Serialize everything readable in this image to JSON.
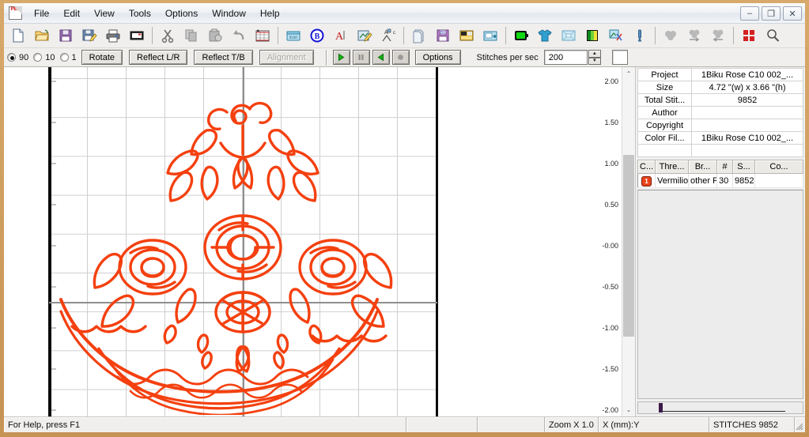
{
  "window": {
    "app_icon": "pes-file-icon",
    "minimize": "–",
    "maximize": "❐",
    "close": "✕"
  },
  "menu": {
    "items": [
      {
        "label": "File",
        "name": "menu-file"
      },
      {
        "label": "Edit",
        "name": "menu-edit"
      },
      {
        "label": "View",
        "name": "menu-view"
      },
      {
        "label": "Tools",
        "name": "menu-tools"
      },
      {
        "label": "Options",
        "name": "menu-options"
      },
      {
        "label": "Window",
        "name": "menu-window"
      },
      {
        "label": "Help",
        "name": "menu-help"
      }
    ]
  },
  "toolbar": {
    "buttons": [
      {
        "icon": "new-document-icon",
        "name": "new-button"
      },
      {
        "icon": "open-folder-icon",
        "name": "open-button"
      },
      {
        "icon": "save-floppy-icon",
        "name": "save-button"
      },
      {
        "icon": "save-as-floppy-pencil-icon",
        "name": "save-as-button"
      },
      {
        "icon": "printer-icon",
        "name": "print-button"
      },
      {
        "icon": "print-preview-icon",
        "name": "print-preview-button"
      },
      {
        "sep": true
      },
      {
        "icon": "scissors-cut-icon",
        "name": "cut-button"
      },
      {
        "icon": "copy-pages-icon",
        "name": "copy-button"
      },
      {
        "icon": "paste-clipboard-icon",
        "name": "paste-button"
      },
      {
        "icon": "undo-arrow-icon",
        "name": "undo-button"
      },
      {
        "icon": "grid-snap-icon",
        "name": "grid-button"
      },
      {
        "sep": true
      },
      {
        "icon": "icon-folder-icon",
        "name": "icon-view-button"
      },
      {
        "icon": "blue-b-circle-icon",
        "name": "b-button"
      },
      {
        "icon": "letter-a-icon",
        "name": "text-button"
      },
      {
        "icon": "edit-design-pencil-icon",
        "name": "edit-design-button"
      },
      {
        "icon": "stitch-path-icon",
        "name": "stitch-path-button"
      },
      {
        "sep": true
      },
      {
        "icon": "layers-stack-icon",
        "name": "layers-button"
      },
      {
        "icon": "floppy-d1-icon",
        "name": "card-write-button"
      },
      {
        "icon": "card-reader-icon",
        "name": "card-read-button"
      },
      {
        "icon": "machine-transfer-icon",
        "name": "machine-transfer-button"
      },
      {
        "sep": true
      },
      {
        "icon": "green-hoop-icon",
        "name": "hoop-button"
      },
      {
        "icon": "tshirt-icon",
        "name": "garment-button"
      },
      {
        "icon": "fabric-frame-icon",
        "name": "fabric-button"
      },
      {
        "icon": "gradient-bars-icon",
        "name": "color-gradient-button"
      },
      {
        "icon": "color-tools-icon",
        "name": "color-tools-button"
      },
      {
        "icon": "needle-icon",
        "name": "needle-button"
      },
      {
        "sep": true
      },
      {
        "icon": "cluster-gray-icon",
        "name": "group-button"
      },
      {
        "icon": "cluster-right-arrow-icon",
        "name": "move-right-button"
      },
      {
        "icon": "cluster-left-arrow-icon",
        "name": "move-left-button"
      },
      {
        "sep": true
      },
      {
        "icon": "four-squares-red-icon",
        "name": "tile-button"
      },
      {
        "icon": "magnifier-icon",
        "name": "zoom-button"
      }
    ]
  },
  "rotate_bar": {
    "radios": [
      {
        "label": "90",
        "selected": true,
        "name": "rotate-90-radio"
      },
      {
        "label": "10",
        "selected": false,
        "name": "rotate-10-radio"
      },
      {
        "label": "1",
        "selected": false,
        "name": "rotate-1-radio"
      }
    ],
    "rotate_label": "Rotate",
    "reflect_lr_label": "Reflect L/R",
    "reflect_tb_label": "Reflect T/B",
    "alignment_label": "Alignment",
    "alignment_disabled": true,
    "play_icon": "play-triangle-icon",
    "pause_icon": "pause-bars-icon",
    "rewind_icon": "play-reverse-triangle-icon",
    "stop_icon": "stop-circle-icon",
    "options_label": "Options",
    "stitches_per_sec_label": "Stitches per sec",
    "stitches_per_sec_value": "200",
    "spin_up": "▲",
    "spin_down": "▼",
    "color_swatch": "#ffffff"
  },
  "canvas": {
    "y_ticks": [
      "2.00",
      "1.50",
      "1.00",
      "0.50",
      "-0.00",
      "-0.50",
      "-1.00",
      "-1.50",
      "-2.00"
    ],
    "thread_color": "#f4400f",
    "scroll_up": "⌃",
    "scroll_down": "⌄"
  },
  "right_panel": {
    "info_rows": [
      {
        "key": "Project",
        "value": "1Biku Rose C10 002_..."
      },
      {
        "key": "Size",
        "value": "4.72 \"(w) x 3.66 \"(h)"
      },
      {
        "key": "Total Stit...",
        "value": "9852"
      },
      {
        "key": "Author",
        "value": ""
      },
      {
        "key": "Copyright",
        "value": ""
      },
      {
        "key": "Color Fil...",
        "value": "1Biku Rose C10 002_..."
      },
      {
        "key": "",
        "value": ""
      }
    ],
    "thread_headers": [
      "C...",
      "Thre...",
      "Br...",
      "#",
      "S...",
      "Co..."
    ],
    "thread_rows": [
      {
        "chip": "1",
        "chip_color": "#e8431a",
        "thread": "Vermilion",
        "brand": "other P",
        "number": "30",
        "stitches": "9852",
        "comment": ""
      }
    ]
  },
  "status_bar": {
    "help_text": "For Help, press F1",
    "pane1": "",
    "pane2": "",
    "zoom": "Zoom X 1.0",
    "coords": "X        (mm):Y",
    "stitches": "STITCHES  9852"
  }
}
